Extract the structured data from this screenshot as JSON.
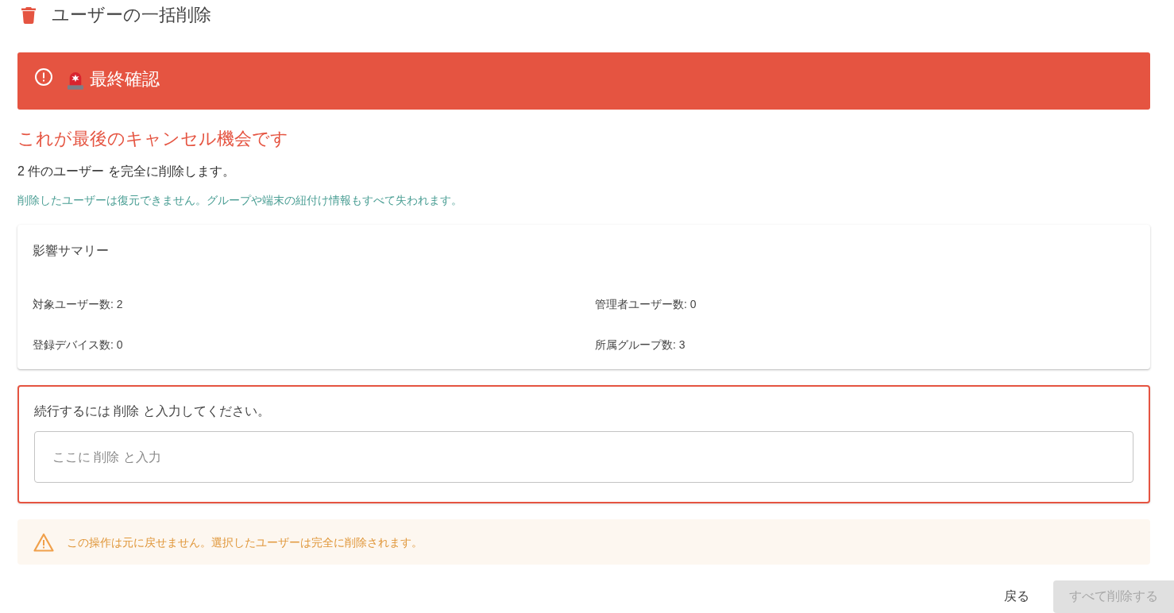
{
  "header": {
    "title": "ユーザーの一括削除"
  },
  "banner": {
    "title": "最終確認"
  },
  "warning_heading": "これが最後のキャンセル機会です",
  "summary_line": "2 件のユーザー を完全に削除します。",
  "note": "削除したユーザーは復元できません。グループや端末の紐付け情報もすべて失われます。",
  "impact_summary": {
    "title": "影響サマリー",
    "items": [
      {
        "label": "対象ユーザー数: 2"
      },
      {
        "label": "管理者ユーザー数: 0"
      },
      {
        "label": "登録デバイス数: 0"
      },
      {
        "label": "所属グループ数: 3"
      }
    ]
  },
  "confirmation": {
    "label": "続行するには 削除 と入力してください。",
    "input": {
      "placeholder": "ここに 削除 と入力"
    }
  },
  "alert": {
    "text": "この操作は元に戻せません。選択したユーザーは完全に削除されます。"
  },
  "buttons": [
    {
      "label": "戻る",
      "kind": "text",
      "disabled": false
    },
    {
      "label": "すべて削除する",
      "kind": "contained",
      "disabled": true
    }
  ]
}
